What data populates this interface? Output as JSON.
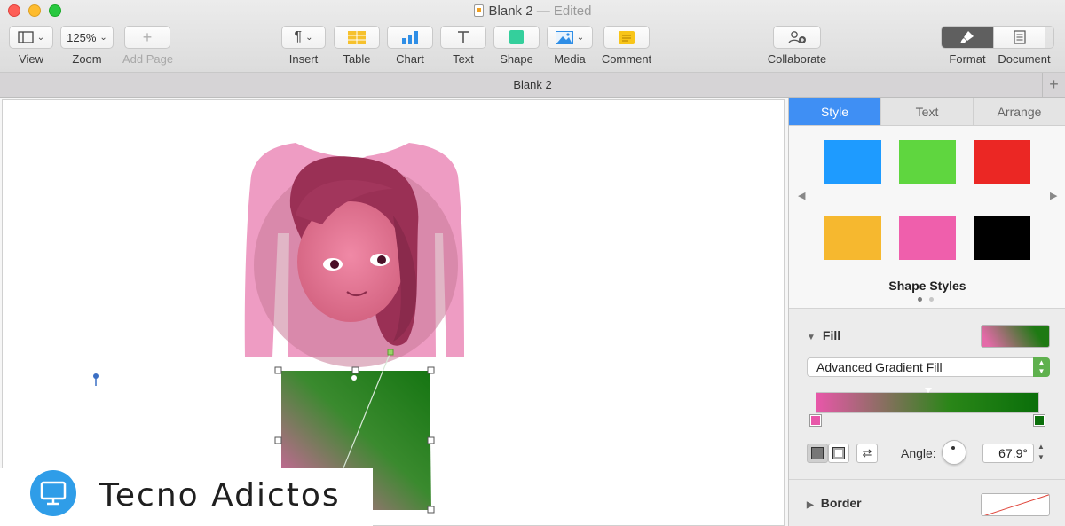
{
  "window": {
    "title": "Blank 2",
    "status": "— Edited"
  },
  "toolbar": {
    "view_label": "View",
    "zoom_value": "125%",
    "zoom_label": "Zoom",
    "add_page_label": "Add Page",
    "insert_label": "Insert",
    "table_label": "Table",
    "chart_label": "Chart",
    "text_label": "Text",
    "shape_label": "Shape",
    "media_label": "Media",
    "comment_label": "Comment",
    "collaborate_label": "Collaborate",
    "format_label": "Format",
    "document_label": "Document"
  },
  "tabbar": {
    "tab_name": "Blank 2",
    "add_symbol": "+"
  },
  "sidebar": {
    "tabs": [
      {
        "label": "Style",
        "active": true
      },
      {
        "label": "Text",
        "active": false
      },
      {
        "label": "Arrange",
        "active": false
      }
    ],
    "shape_styles": {
      "title": "Shape Styles",
      "swatches": [
        "#1e9bff",
        "#5fd63f",
        "#eb2724",
        "#f6b82f",
        "#ef5fac",
        "#000000"
      ]
    },
    "fill": {
      "label": "Fill",
      "type": "Advanced Gradient Fill",
      "start_color": "#e857a9",
      "end_color": "#0a6f0a",
      "angle_label": "Angle:",
      "angle_value": "67.9°"
    },
    "border": {
      "label": "Border"
    }
  },
  "watermark": {
    "text": "Tecno Adictos"
  }
}
